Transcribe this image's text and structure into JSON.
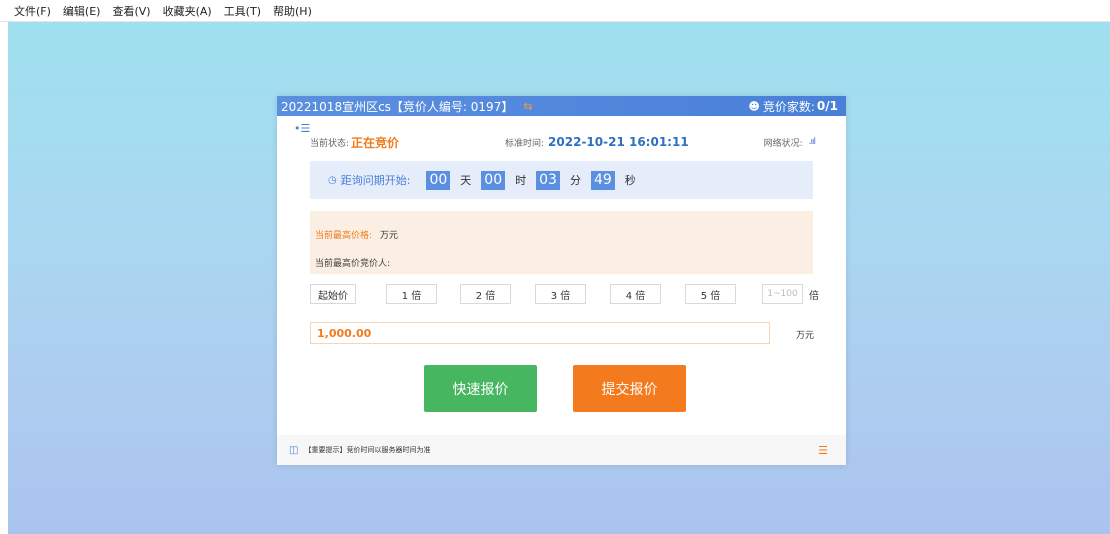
{
  "menubar": {
    "items": [
      "文件(F)",
      "编辑(E)",
      "查看(V)",
      "收藏夹(A)",
      "工具(T)",
      "帮助(H)"
    ]
  },
  "header": {
    "title": "20221018宣州区cs【竞价人编号: 0197】",
    "swap_icon": "⇆",
    "bidders_label": "竞价家数:",
    "bidders_count": "0/1"
  },
  "status": {
    "current_label": "当前状态:",
    "current_value": "正在竞价",
    "time_label": "标准时间:",
    "time_value": "2022-10-21 16:01:11",
    "network_label": "网络状况:"
  },
  "countdown": {
    "label": "距询问期开始:",
    "days": "00",
    "days_unit": "天",
    "hours": "00",
    "hours_unit": "时",
    "minutes": "03",
    "minutes_unit": "分",
    "seconds": "49",
    "seconds_unit": "秒"
  },
  "price": {
    "highest_label": "当前最高价格:",
    "highest_unit": "万元",
    "bidder_label": "当前最高价竞价人:"
  },
  "multipliers": {
    "start_label": "起始价",
    "buttons": [
      "1 倍",
      "2 倍",
      "3 倍",
      "4 倍",
      "5 倍"
    ],
    "input_placeholder": "1~100",
    "suffix": "倍"
  },
  "amount": {
    "value": "1,000.00",
    "unit": "万元"
  },
  "actions": {
    "quick": "快速报价",
    "submit": "提交报价"
  },
  "footer": {
    "tip": "【重要提示】竞价时间以服务器时间为准"
  },
  "colors": {
    "header": "#4a7fd8",
    "accent_orange": "#f07b1d",
    "quick_button": "#47b660",
    "submit_button": "#f37a1d"
  }
}
